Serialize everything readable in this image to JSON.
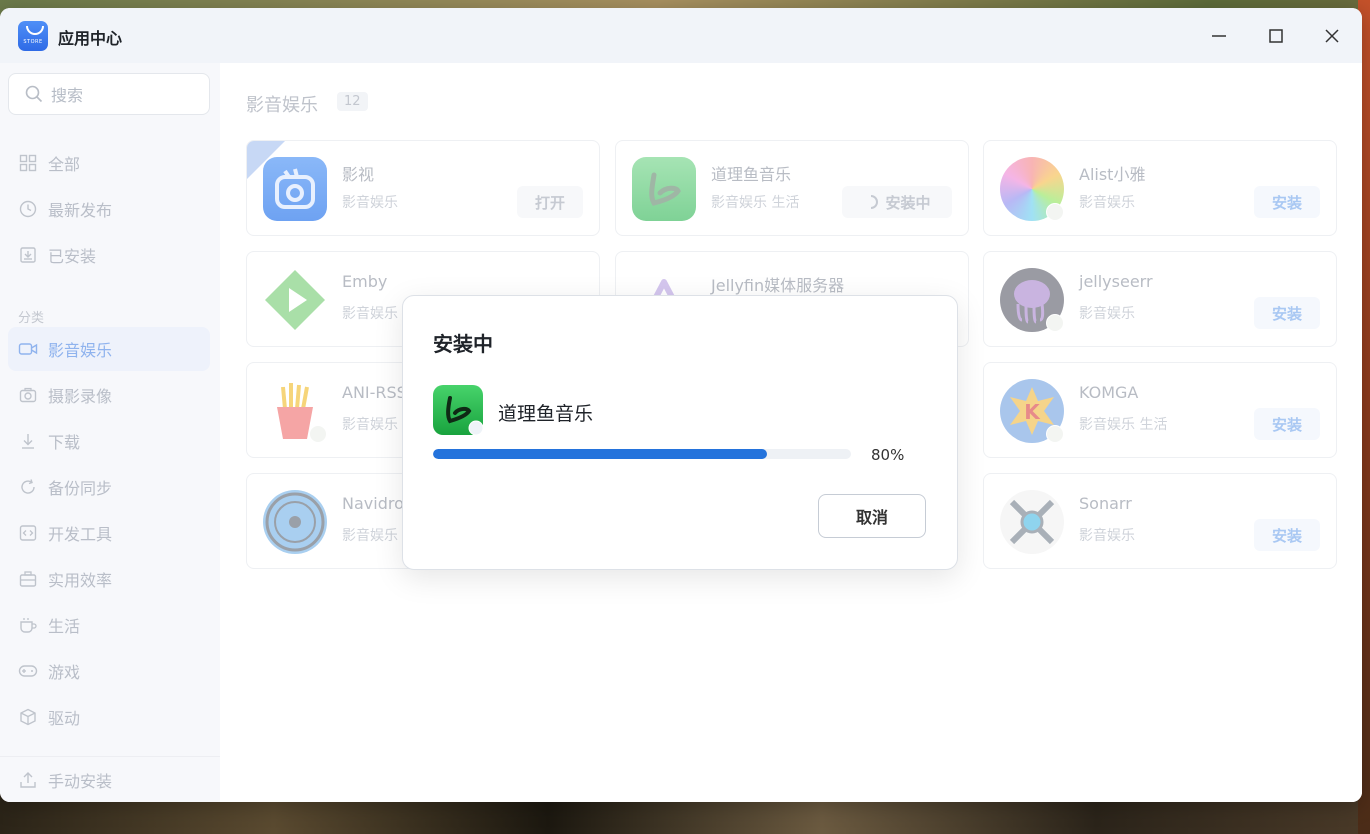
{
  "app": {
    "title": "应用中心",
    "logo_text": "STORE"
  },
  "sidebar": {
    "search_placeholder": "搜索",
    "top_items": [
      {
        "label": "全部",
        "icon": "grid-icon"
      },
      {
        "label": "最新发布",
        "icon": "clock-icon"
      },
      {
        "label": "已安装",
        "icon": "installed-icon"
      }
    ],
    "section_label": "分类",
    "categories": [
      {
        "label": "影音娱乐",
        "icon": "video-icon",
        "active": true
      },
      {
        "label": "摄影录像",
        "icon": "camera-icon"
      },
      {
        "label": "下载",
        "icon": "download-icon"
      },
      {
        "label": "备份同步",
        "icon": "sync-icon"
      },
      {
        "label": "开发工具",
        "icon": "code-icon"
      },
      {
        "label": "实用效率",
        "icon": "toolbox-icon"
      },
      {
        "label": "生活",
        "icon": "coffee-icon"
      },
      {
        "label": "游戏",
        "icon": "gamepad-icon"
      },
      {
        "label": "驱动",
        "icon": "cube-icon"
      }
    ],
    "manual_install": "手动安装"
  },
  "main": {
    "category_title": "影音娱乐",
    "category_count": "12",
    "apps": [
      {
        "name": "影视",
        "category": "影音娱乐",
        "button": "打开"
      },
      {
        "name": "道理鱼音乐",
        "category": "影音娱乐 生活",
        "button": "安装中"
      },
      {
        "name": "Alist小雅",
        "category": "影音娱乐",
        "button": "安装"
      },
      {
        "name": "Emby",
        "category": "影音娱乐",
        "button": ""
      },
      {
        "name": "Jellyfin媒体服务器",
        "category": "",
        "button": ""
      },
      {
        "name": "jellyseerr",
        "category": "影音娱乐",
        "button": "安装"
      },
      {
        "name": "ANI-RSS",
        "category": "影音娱乐",
        "button": ""
      },
      {
        "name": "KOMGA",
        "category": "影音娱乐 生活",
        "button": "安装"
      },
      {
        "name": "Navidrome",
        "category": "影音娱乐",
        "button": ""
      },
      {
        "name": "Sonarr",
        "category": "影音娱乐",
        "button": "安装"
      }
    ]
  },
  "dialog": {
    "title": "安装中",
    "app_name": "道理鱼音乐",
    "progress": 80,
    "progress_text": "80%",
    "cancel": "取消"
  }
}
